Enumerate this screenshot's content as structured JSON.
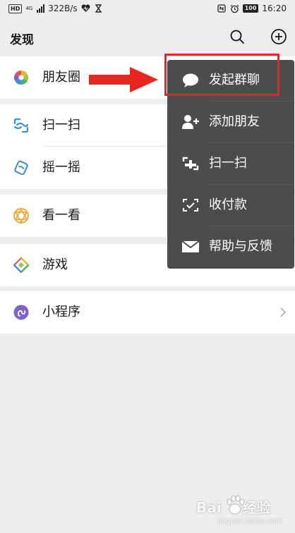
{
  "status_bar": {
    "hd": "HD",
    "network": "4G",
    "speed": "322B/s",
    "battery": "100",
    "time": "16:20"
  },
  "header": {
    "title": "发现"
  },
  "list": [
    {
      "label": "朋友圈",
      "icon": "moments-icon"
    },
    {
      "label": "扫一扫",
      "icon": "scan-icon"
    },
    {
      "label": "摇一摇",
      "icon": "shake-icon"
    },
    {
      "label": "看一看",
      "icon": "top-stories-icon"
    },
    {
      "label": "游戏",
      "icon": "games-icon"
    },
    {
      "label": "小程序",
      "icon": "mini-programs-icon"
    }
  ],
  "popup_menu": [
    {
      "label": "发起群聊",
      "icon": "chat-bubble-icon"
    },
    {
      "label": "添加朋友",
      "icon": "add-friend-icon"
    },
    {
      "label": "扫一扫",
      "icon": "scan-icon"
    },
    {
      "label": "收付款",
      "icon": "money-icon"
    },
    {
      "label": "帮助与反馈",
      "icon": "mail-icon"
    }
  ],
  "watermark": {
    "text": "Bai",
    "text2": "经验",
    "sub": "jingyan.baidu.com"
  },
  "colors": {
    "background": "#ededed",
    "popup": "#4c4c4c",
    "highlight": "#e8251e"
  }
}
